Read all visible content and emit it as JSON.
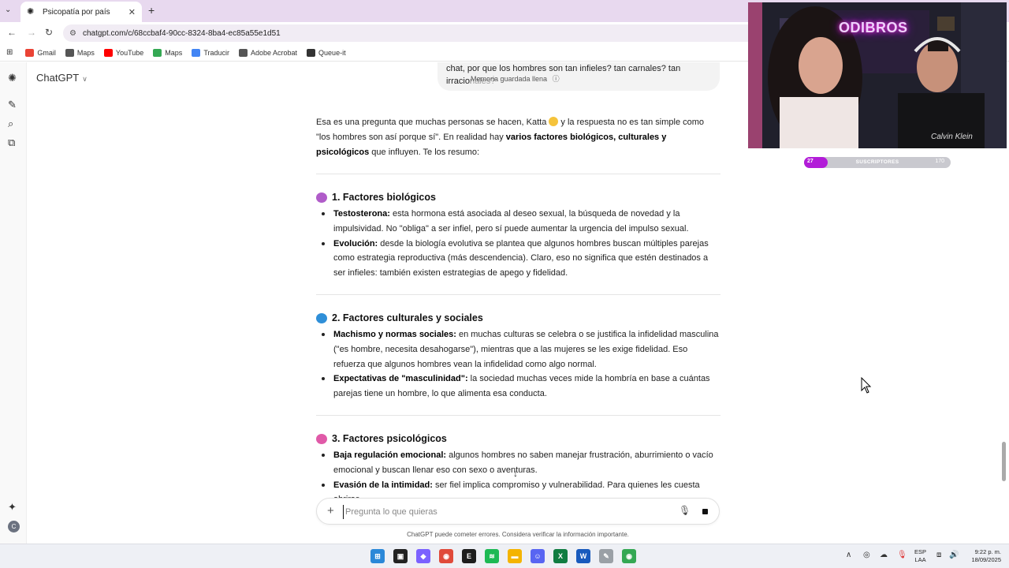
{
  "browser": {
    "tab_title": "Psicopatía por país",
    "url": "chatgpt.com/c/68ccbaf4-90cc-8324-8ba4-ec85a55e1d51",
    "bookmarks": [
      {
        "label": "Gmail",
        "icon": "gmail-icon",
        "color": "#ea4335"
      },
      {
        "label": "Maps",
        "icon": "globe-icon",
        "color": "#555555"
      },
      {
        "label": "YouTube",
        "icon": "youtube-icon",
        "color": "#ff0000"
      },
      {
        "label": "Maps",
        "icon": "maps-pin-icon",
        "color": "#34a853"
      },
      {
        "label": "Traducir",
        "icon": "translate-icon",
        "color": "#4285f4"
      },
      {
        "label": "Adobe Acrobat",
        "icon": "globe-icon",
        "color": "#555555"
      },
      {
        "label": "Queue-it",
        "icon": "queue-icon",
        "color": "#333333"
      }
    ]
  },
  "header": {
    "model_label": "ChatGPT"
  },
  "conversation": {
    "user_message": "chat, por que los hombres son tan infieles? tan carnales? tan irracionales?",
    "memory_note": "Memoria guardada llena",
    "intro_pre": "Esa es una pregunta que muchas personas se hacen, Katta",
    "intro_mid": " y la respuesta no es tan simple como \"los hombres son así porque sí\". En realidad hay ",
    "intro_bold": "varios factores biológicos, culturales y psicológicos",
    "intro_post": " que influyen. Te los resumo:",
    "sections": [
      {
        "title": "1. Factores biológicos",
        "emoji_color": "#b05cc9",
        "items": [
          {
            "term": "Testosterona:",
            "text": " esta hormona está asociada al deseo sexual, la búsqueda de novedad y la impulsividad. No \"obliga\" a ser infiel, pero sí puede aumentar la urgencia del impulso sexual."
          },
          {
            "term": "Evolución:",
            "text": " desde la biología evolutiva se plantea que algunos hombres buscan múltiples parejas como estrategia reproductiva (más descendencia). Claro, eso no significa que estén destinados a ser infieles: también existen estrategias de apego y fidelidad."
          }
        ]
      },
      {
        "title": "2. Factores culturales y sociales",
        "emoji_color": "#2f8fd8",
        "items": [
          {
            "term": "Machismo y normas sociales:",
            "text": " en muchas culturas se celebra o se justifica la infidelidad masculina (\"es hombre, necesita desahogarse\"), mientras que a las mujeres se les exige fidelidad. Eso refuerza que algunos hombres vean la infidelidad como algo normal."
          },
          {
            "term": "Expectativas de \"masculinidad\":",
            "text": " la sociedad muchas veces mide la hombría en base a cuántas parejas tiene un hombre, lo que alimenta esa conducta."
          }
        ]
      },
      {
        "title": "3. Factores psicológicos",
        "emoji_color": "#e05aa8",
        "items": [
          {
            "term": "Baja regulación emocional:",
            "text": " algunos hombres no saben manejar frustración, aburrimiento o vacío emocional y buscan llenar eso con sexo o aventuras."
          },
          {
            "term": "Evasión de la intimidad:",
            "text": " ser fiel implica compromiso y vulnerabilidad. Para quienes les cuesta abrirse"
          }
        ]
      }
    ]
  },
  "composer": {
    "placeholder": "Pregunta lo que quieras",
    "disclaimer": "ChatGPT puede cometer errores. Considera verificar la información importante."
  },
  "sidebar": {
    "avatar_letter": "C"
  },
  "stream_overlay": {
    "neon_sign": "ODIBROS",
    "shirt_text": "Calvin Klein",
    "subs_current": "27",
    "subs_label": "SUSCRIPTORES",
    "subs_goal": "170",
    "subs_progress": 0.16,
    "accent": "#b21cd8"
  },
  "taskbar": {
    "lang_line1": "ESP",
    "lang_line2": "LAA",
    "time": "9:22 p. m.",
    "date": "18/09/2025",
    "apps": [
      {
        "name": "windows-start-icon",
        "color": "#2b88d8",
        "glyph": "⊞"
      },
      {
        "name": "terminal-icon",
        "color": "#222222",
        "glyph": "▣"
      },
      {
        "name": "copilot-icon",
        "color": "#7b61ff",
        "glyph": "◆"
      },
      {
        "name": "chrome-icon",
        "color": "#e04a3a",
        "glyph": "◉"
      },
      {
        "name": "epic-games-icon",
        "color": "#1d1d1d",
        "glyph": "E"
      },
      {
        "name": "spotify-icon",
        "color": "#1db954",
        "glyph": "≋"
      },
      {
        "name": "file-explorer-icon",
        "color": "#f4b400",
        "glyph": "▬"
      },
      {
        "name": "discord-icon",
        "color": "#5865f2",
        "glyph": "☺"
      },
      {
        "name": "excel-icon",
        "color": "#107c41",
        "glyph": "X"
      },
      {
        "name": "word-icon",
        "color": "#185abd",
        "glyph": "W"
      },
      {
        "name": "notepad-icon",
        "color": "#9aa0a6",
        "glyph": "✎"
      },
      {
        "name": "chrome-profile-icon",
        "color": "#34a853",
        "glyph": "◉"
      }
    ]
  }
}
